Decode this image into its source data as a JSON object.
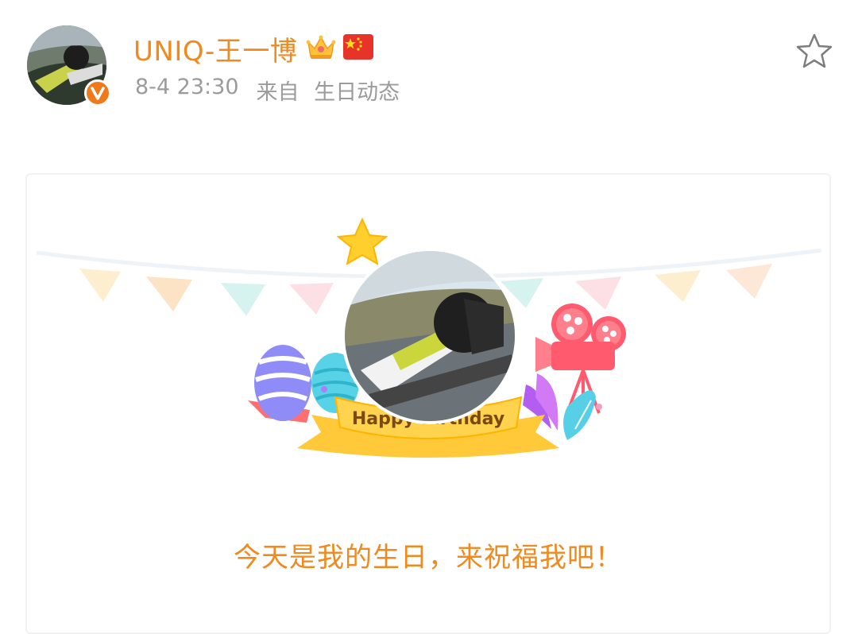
{
  "post": {
    "username": "UNIQ-王一博",
    "timestamp": "8-4 23:30",
    "source_prefix": "来自",
    "source_name": "生日动态"
  },
  "icons": {
    "avatar": "avatar-photo",
    "verified": "verified-v-badge",
    "crown": "crown-icon",
    "flag": "china-flag-icon",
    "favorite": "star-outline-icon"
  },
  "card": {
    "ribbon_text": "Happy Birthday",
    "message": "今天是我的生日，来祝福我吧！"
  },
  "colors": {
    "accent": "#f0891e",
    "meta": "#9b9b9b",
    "badge": "#f07a1a",
    "ribbon": "#ffd34d"
  }
}
